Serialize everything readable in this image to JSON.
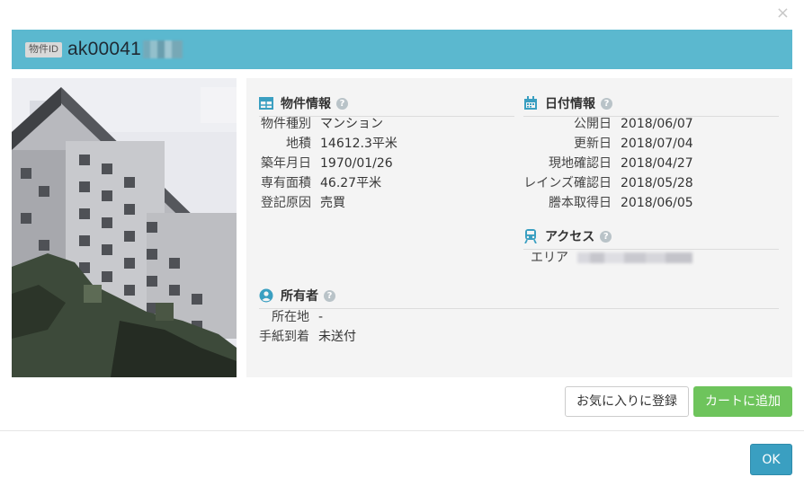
{
  "dialog": {
    "close_glyph": "×"
  },
  "header": {
    "id_badge": "物件ID",
    "id_text": "ak00041",
    "id_suffix_redacted": true
  },
  "property_info": {
    "title": "物件情報",
    "icon": "table-icon",
    "help": "?",
    "rows": [
      {
        "label": "物件種別",
        "value": "マンション"
      },
      {
        "label": "地積",
        "value": "14612.3平米"
      },
      {
        "label": "築年月日",
        "value": "1970/01/26"
      },
      {
        "label": "専有面積",
        "value": "46.27平米"
      },
      {
        "label": "登記原因",
        "value": "売買"
      }
    ]
  },
  "date_info": {
    "title": "日付情報",
    "icon": "calendar-icon",
    "help": "?",
    "rows": [
      {
        "label": "公開日",
        "value": "2018/06/07"
      },
      {
        "label": "更新日",
        "value": "2018/07/04"
      },
      {
        "label": "現地確認日",
        "value": "2018/04/27"
      },
      {
        "label": "レインズ確認日",
        "value": "2018/05/28"
      },
      {
        "label": "謄本取得日",
        "value": "2018/06/05"
      }
    ]
  },
  "access": {
    "title": "アクセス",
    "icon": "train-icon",
    "help": "?",
    "rows": [
      {
        "label": "エリア",
        "value_redacted": true
      }
    ]
  },
  "owner": {
    "title": "所有者",
    "icon": "user-circle-icon",
    "help": "?",
    "rows": [
      {
        "label": "所在地",
        "value": "-"
      },
      {
        "label": "手紙到着",
        "value": "未送付"
      }
    ]
  },
  "actions": {
    "favorite": "お気に入りに登録",
    "cart": "カートに追加",
    "ok": "OK"
  },
  "colors": {
    "header": "#5bb8cf",
    "cart": "#6ec45c",
    "ok": "#3a9fc1",
    "icon": "#3a9fc1"
  }
}
